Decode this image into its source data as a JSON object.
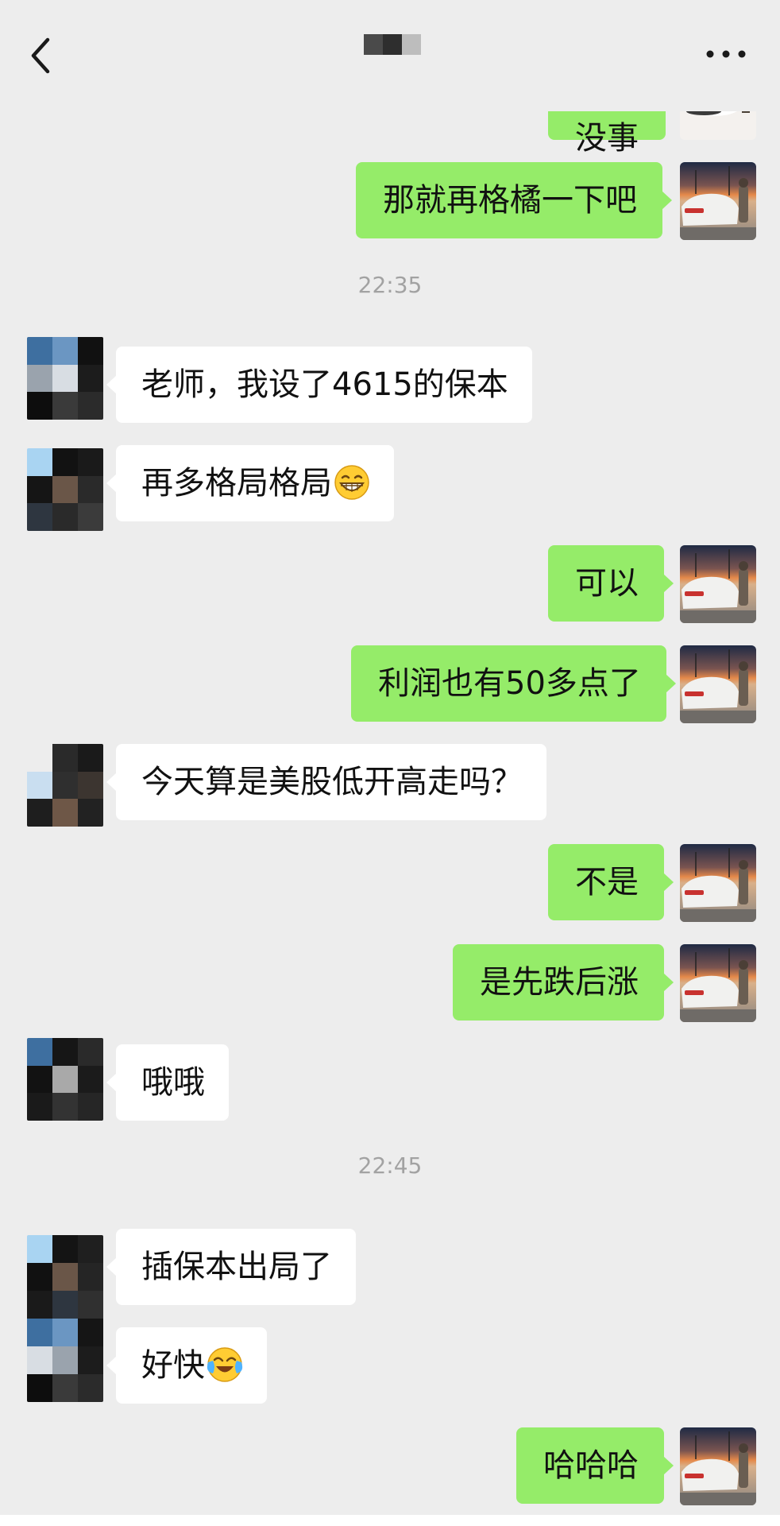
{
  "chat": {
    "partial_top_text": "没事",
    "messages": [
      {
        "from": "me",
        "text": "那就再格橘一下吧"
      },
      {
        "time": "22:35"
      },
      {
        "from": "them",
        "text": "老师，我设了4615的保本"
      },
      {
        "from": "them",
        "text": "再多格局格局"
      },
      {
        "from": "me",
        "text": "可以"
      },
      {
        "from": "me",
        "text": "利润也有50多点了"
      },
      {
        "from": "them",
        "text": "今天算是美股低开高走吗？"
      },
      {
        "from": "me",
        "text": "不是"
      },
      {
        "from": "me",
        "text": "是先跌后涨"
      },
      {
        "from": "them",
        "text": "哦哦"
      },
      {
        "time": "22:45"
      },
      {
        "from": "them",
        "text": "插保本出局了"
      },
      {
        "from": "them",
        "text": "好快"
      },
      {
        "from": "me",
        "text": "哈哈哈"
      }
    ]
  },
  "icons": {
    "back": "chevron-left-icon",
    "more": "more-dots-icon",
    "grin_emoji": "grinning-emoji-icon",
    "crying_emoji": "crying-laughing-emoji-icon"
  },
  "colors": {
    "background": "#ededed",
    "my_bubble": "#95ec69",
    "their_bubble": "#ffffff",
    "timestamp": "#a2a2a2"
  }
}
